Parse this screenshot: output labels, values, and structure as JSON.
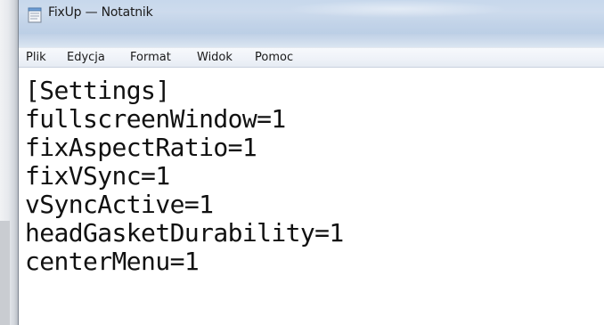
{
  "window": {
    "title": "FixUp — Notatnik",
    "icon": "notepad-icon"
  },
  "menubar": {
    "items": [
      {
        "label": "Plik"
      },
      {
        "label": "Edycja"
      },
      {
        "label": "Format"
      },
      {
        "label": "Widok"
      },
      {
        "label": "Pomoc"
      }
    ]
  },
  "editor": {
    "lines": [
      "[Settings]",
      "fullscreenWindow=1",
      "fixAspectRatio=1",
      "fixVSync=1",
      "vSyncActive=1",
      "headGasketDurability=1",
      "centerMenu=1"
    ]
  },
  "colors": {
    "titlebar": "#c7d8ec",
    "menubar": "#eef2f8",
    "text": "#111111"
  }
}
